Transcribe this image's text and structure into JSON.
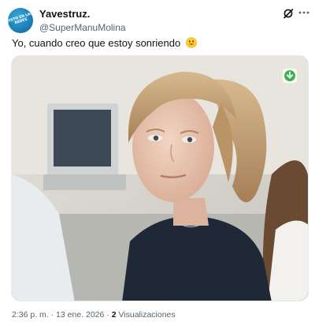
{
  "author": {
    "display_name": "Yavestruz.",
    "handle": "@SuperManuMolina",
    "avatar_text": "VISTO EN LAS REDES"
  },
  "tweet": {
    "text": "Yo, cuando creo que estoy sonriendo",
    "emoji": "smiling-face-emoji"
  },
  "meta": {
    "time": "2:36 p. m.",
    "separator1": "·",
    "date": "13 ene. 2026",
    "separator2": "·",
    "views_count": "2",
    "views_label": "Visualizaciones"
  },
  "icons": {
    "grok": "grok-icon",
    "more": "more-icon",
    "download": "download-icon"
  },
  "colors": {
    "text_primary": "#0f1419",
    "text_secondary": "#536471",
    "avatar_bg": "#1c7fb6",
    "download_badge": "#37b34a"
  }
}
